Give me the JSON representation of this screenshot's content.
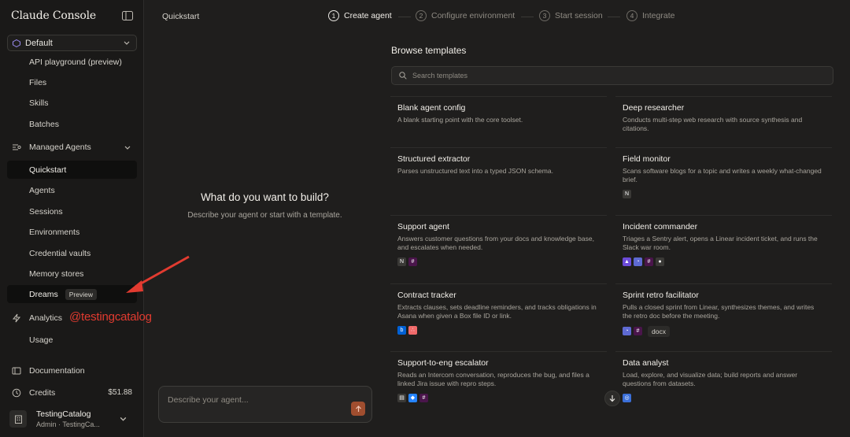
{
  "app": {
    "title": "Claude Console"
  },
  "workspace": {
    "name": "Default"
  },
  "sidebar": {
    "items_top": [
      {
        "label": "API playground (preview)"
      },
      {
        "label": "Files"
      },
      {
        "label": "Skills"
      },
      {
        "label": "Batches"
      }
    ],
    "managed_agents": {
      "label": "Managed Agents"
    },
    "managed_items": [
      {
        "label": "Quickstart"
      },
      {
        "label": "Agents"
      },
      {
        "label": "Sessions"
      },
      {
        "label": "Environments"
      },
      {
        "label": "Credential vaults"
      },
      {
        "label": "Memory stores"
      },
      {
        "label": "Dreams",
        "badge": "Preview"
      }
    ],
    "analytics": {
      "label": "Analytics"
    },
    "usage": {
      "label": "Usage"
    },
    "documentation": {
      "label": "Documentation"
    },
    "credits": {
      "label": "Credits",
      "value": "$51.88"
    }
  },
  "overlay": {
    "handle": "@testingcatalog"
  },
  "user": {
    "name": "TestingCatalog",
    "role": "Admin · TestingCa..."
  },
  "header": {
    "title": "Quickstart",
    "steps": [
      {
        "num": "1",
        "label": "Create agent"
      },
      {
        "num": "2",
        "label": "Configure environment"
      },
      {
        "num": "3",
        "label": "Start session"
      },
      {
        "num": "4",
        "label": "Integrate"
      }
    ]
  },
  "hero": {
    "title": "What do you want to build?",
    "subtitle": "Describe your agent or start with a template."
  },
  "composer": {
    "placeholder": "Describe your agent..."
  },
  "templates": {
    "title": "Browse templates",
    "search_placeholder": "Search templates",
    "cards": [
      {
        "title": "Blank agent config",
        "desc": "A blank starting point with the core toolset."
      },
      {
        "title": "Deep researcher",
        "desc": "Conducts multi-step web research with source synthesis and citations."
      },
      {
        "title": "Structured extractor",
        "desc": "Parses unstructured text into a typed JSON schema."
      },
      {
        "title": "Field monitor",
        "desc": "Scans software blogs for a topic and writes a weekly what-changed brief."
      },
      {
        "title": "Support agent",
        "desc": "Answers customer questions from your docs and knowledge base, and escalates when needed."
      },
      {
        "title": "Incident commander",
        "desc": "Triages a Sentry alert, opens a Linear incident ticket, and runs the Slack war room."
      },
      {
        "title": "Contract tracker",
        "desc": "Extracts clauses, sets deadline reminders, and tracks obligations in Asana when given a Box file ID or link."
      },
      {
        "title": "Sprint retro facilitator",
        "desc": "Pulls a closed sprint from Linear, synthesizes themes, and writes the retro doc before the meeting.",
        "chip": "docx"
      },
      {
        "title": "Support-to-eng escalator",
        "desc": "Reads an Intercom conversation, reproduces the bug, and files a linked Jira issue with repro steps."
      },
      {
        "title": "Data analyst",
        "desc": "Load, explore, and visualize data; build reports and answer questions from datasets."
      }
    ]
  },
  "colors": {
    "accent": "#a04e2f",
    "annotation": "#e23b30"
  }
}
